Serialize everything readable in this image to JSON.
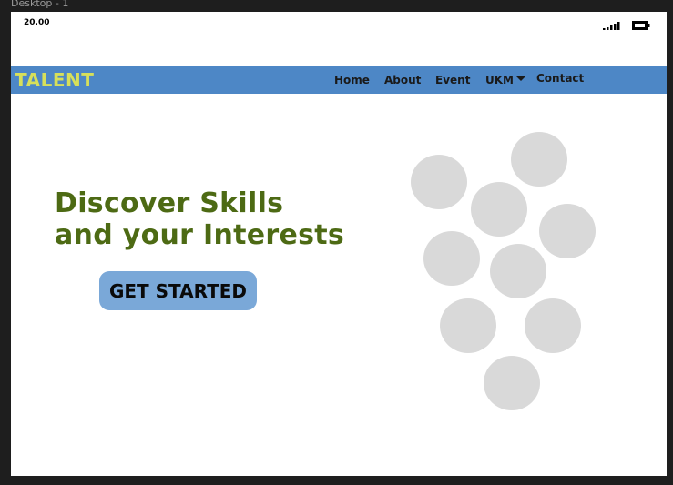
{
  "canvas": {
    "frame_label": "Desktop - 1"
  },
  "status_bar": {
    "time": "20.00",
    "signal_icon": "signal-bars-icon",
    "battery_icon": "battery-icon"
  },
  "navbar": {
    "logo": "TALENT",
    "background": "#4d87c6",
    "logo_color": "#d7e05a",
    "items": [
      {
        "label": "Home"
      },
      {
        "label": "About"
      },
      {
        "label": "Event"
      },
      {
        "label": "UKM",
        "dropdown_icon": "caret-down-icon"
      },
      {
        "label": "Contact"
      }
    ]
  },
  "hero": {
    "title_line1": "Discover Skills",
    "title_line2": "and your Interests",
    "title_color": "#4d6a14",
    "cta_label": "GET STARTED",
    "cta_color": "#7aa8d8"
  },
  "decoration": {
    "bubble_count": 10,
    "bubble_color": "#d9d9d9"
  }
}
